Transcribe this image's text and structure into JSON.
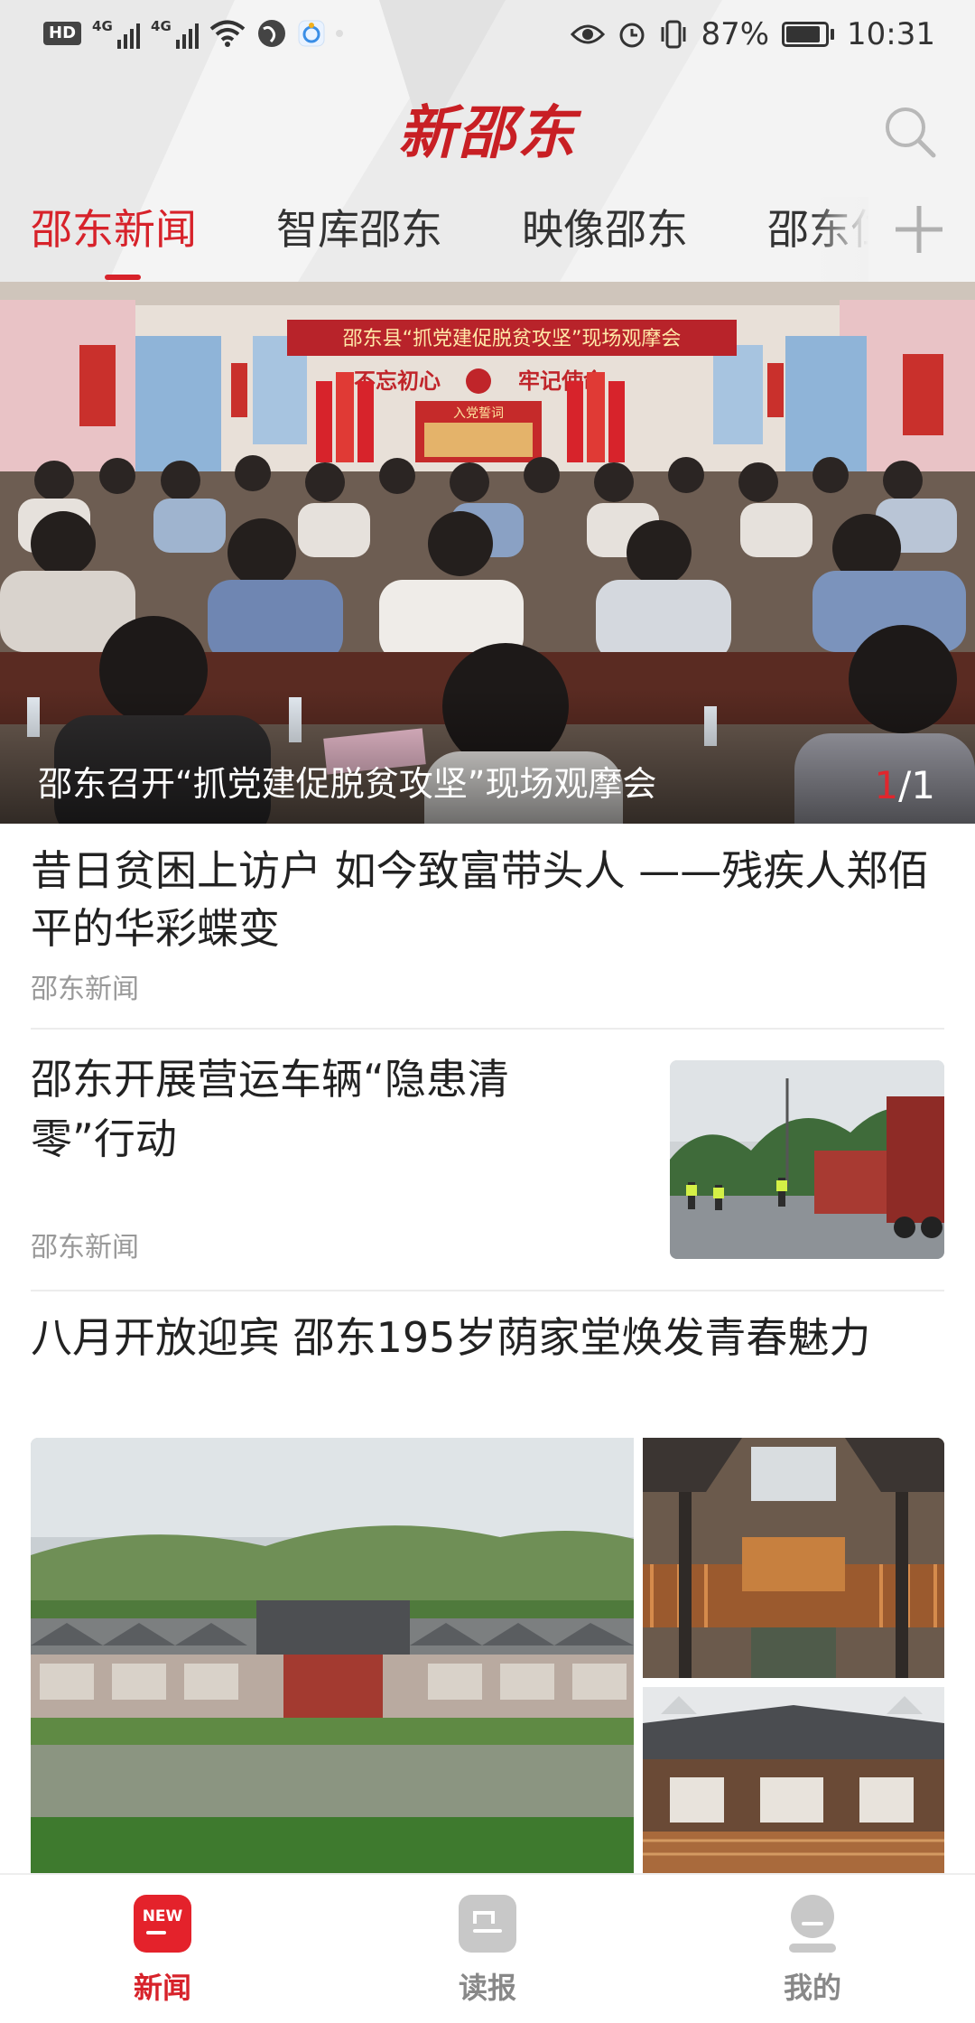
{
  "status_bar": {
    "left_badges": [
      "HD",
      "4G",
      "4G"
    ],
    "battery": "87%",
    "battery_level": 0.87,
    "time": "10:31",
    "icons": [
      "wifi-icon",
      "globe-icon",
      "lotus-app-icon",
      "eye-icon",
      "alarm-icon",
      "vibrate-icon",
      "battery-icon"
    ]
  },
  "header": {
    "logo": "新邵东",
    "search_icon": "search-icon",
    "add_icon": "plus-icon"
  },
  "tabs": [
    {
      "label": "邵东新闻",
      "active": true
    },
    {
      "label": "智库邵东",
      "active": false
    },
    {
      "label": "映像邵东",
      "active": false
    },
    {
      "label": "邵东仁",
      "active": false
    }
  ],
  "banner": {
    "caption": "邵东召开“抓党建促脱贫攻坚”现场观摩会",
    "page_current": "1",
    "page_sep_total": "/1",
    "photo_text": {
      "meeting_title": "邵东县“抓党建促脱贫攻坚”现场观摩会",
      "slogan_left": "不忘初心",
      "slogan_right": "牢记使命",
      "board_title": "入党誓词"
    }
  },
  "articles": [
    {
      "title": "昔日贫困上访户 如今致富带头人 ——残疾人郑佰平的华彩蝶变",
      "source": "邵东新闻"
    },
    {
      "title": "邵东开展营运车辆“隐患清零”行动",
      "source": "邵东新闻"
    },
    {
      "title": "八月开放迎宾 邵东195岁荫家堂焕发青春魅力"
    }
  ],
  "bottom_nav": [
    {
      "label": "新闻",
      "icon": "news-icon",
      "badge": "NEW",
      "active": true
    },
    {
      "label": "读报",
      "icon": "newspaper-icon",
      "active": false
    },
    {
      "label": "我的",
      "icon": "profile-icon",
      "active": false
    }
  ],
  "colors": {
    "accent": "#d7222a",
    "inactive": "#888888",
    "source": "#999999"
  }
}
